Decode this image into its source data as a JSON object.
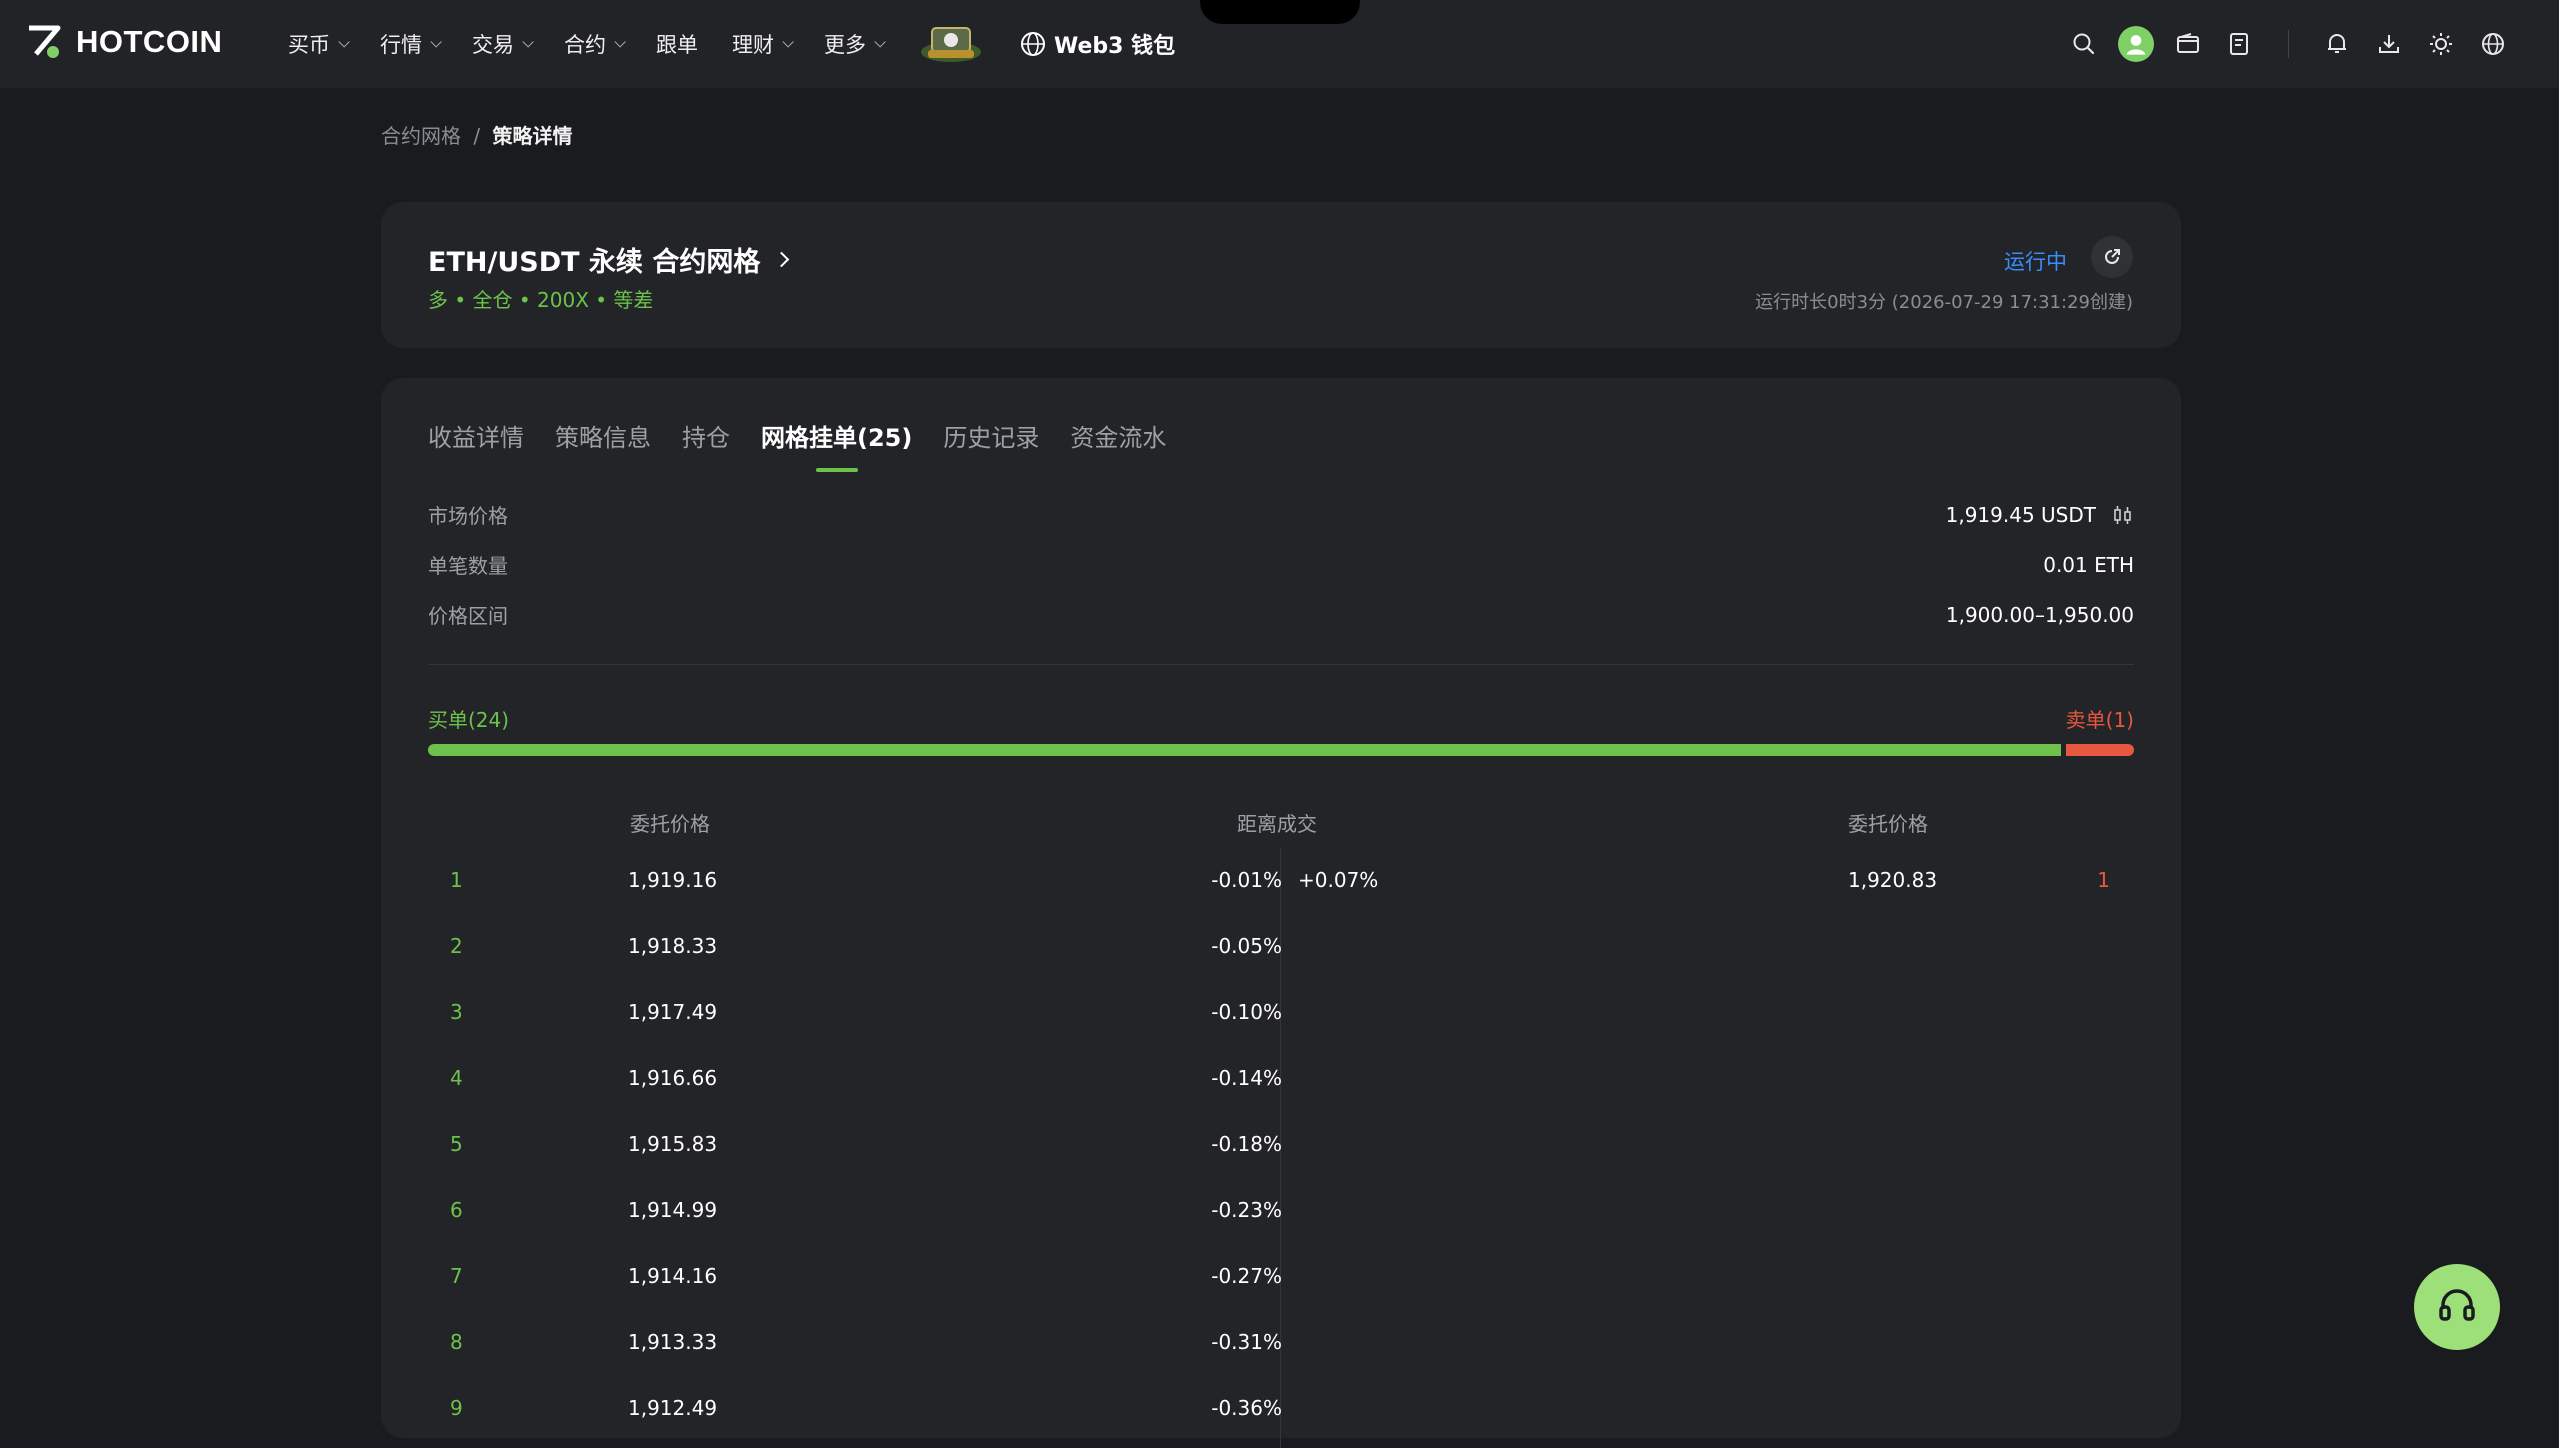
{
  "header": {
    "logo_text": "HOTCOIN",
    "nav": [
      {
        "label": "买币",
        "dropdown": true
      },
      {
        "label": "行情",
        "dropdown": true
      },
      {
        "label": "交易",
        "dropdown": true
      },
      {
        "label": "合约",
        "dropdown": true
      },
      {
        "label": "跟单",
        "dropdown": false
      },
      {
        "label": "理财",
        "dropdown": true
      },
      {
        "label": "更多",
        "dropdown": true
      }
    ],
    "web3_label": "Web3 钱包",
    "accent": "#7ed067"
  },
  "breadcrumb": {
    "parent": "合约网格",
    "separator": "/",
    "current": "策略详情"
  },
  "strategy": {
    "title": "ETH/USDT 永续 合约网格",
    "tags": "多 • 全仓 • 200X • 等差",
    "status": "运行中",
    "runtime": "运行时长0时3分 (2026-07-29 17:31:29创建)"
  },
  "tabs": [
    "收益详情",
    "策略信息",
    "持仓",
    "网格挂单(25)",
    "历史记录",
    "资金流水"
  ],
  "active_tab": 3,
  "info": [
    {
      "label": "市场价格",
      "value": "1,919.45 USDT"
    },
    {
      "label": "单笔数量",
      "value": "0.01 ETH"
    },
    {
      "label": "价格区间",
      "value": "1,900.00–1,950.00"
    }
  ],
  "orders": {
    "buy_label": "买单(24)",
    "sell_label": "卖单(1)",
    "buy_count": 24,
    "sell_count": 1,
    "col_buy_price": "委托价格",
    "col_distance": "距离成交",
    "col_sell_price": "委托价格",
    "buy_rows": [
      {
        "idx": "1",
        "price": "1,919.16",
        "dist": "-0.01%"
      },
      {
        "idx": "2",
        "price": "1,918.33",
        "dist": "-0.05%"
      },
      {
        "idx": "3",
        "price": "1,917.49",
        "dist": "-0.10%"
      },
      {
        "idx": "4",
        "price": "1,916.66",
        "dist": "-0.14%"
      },
      {
        "idx": "5",
        "price": "1,915.83",
        "dist": "-0.18%"
      },
      {
        "idx": "6",
        "price": "1,914.99",
        "dist": "-0.23%"
      },
      {
        "idx": "7",
        "price": "1,914.16",
        "dist": "-0.27%"
      },
      {
        "idx": "8",
        "price": "1,913.33",
        "dist": "-0.31%"
      },
      {
        "idx": "9",
        "price": "1,912.49",
        "dist": "-0.36%"
      }
    ],
    "sell_rows": [
      {
        "idx": "1",
        "price": "1,920.83",
        "dist": "+0.07%"
      }
    ]
  },
  "colors": {
    "buy": "#6cc24a",
    "sell": "#e8573f",
    "status": "#3a8dff"
  }
}
